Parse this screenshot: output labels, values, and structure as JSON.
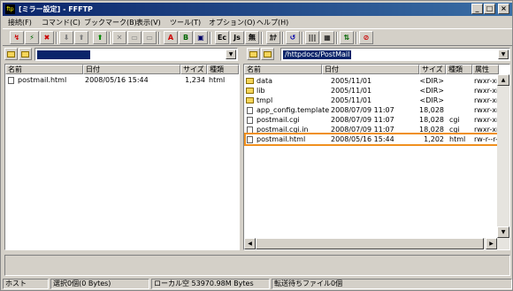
{
  "window": {
    "title": "[ミラー設定] - FFFTP",
    "app_icon_text": "ftp",
    "controls": {
      "minimize": "_",
      "maximize": "□",
      "close": "×"
    }
  },
  "menu": [
    "接続(F)",
    "コマンド(C)",
    "ブックマーク(B)",
    "表示(V)",
    "ツール(T)",
    "オプション(O)",
    "ヘルプ(H)"
  ],
  "toolbar": {
    "buttons": [
      "↯",
      "⚡",
      "✖",
      "⬇",
      "⬆",
      "⬆",
      "✕",
      "▭",
      "▭",
      "A",
      "B",
      "▣",
      "Ec",
      "Js",
      "無",
      "ｶﾅ",
      "↺",
      "|||",
      "▦",
      "⇅",
      "⊘"
    ]
  },
  "local": {
    "path": "",
    "headers": {
      "name": "名前",
      "date": "日付",
      "size": "サイズ",
      "type": "種類"
    },
    "files": [
      {
        "name": "postmail.html",
        "date": "2008/05/16 15:44",
        "size": "1,234",
        "type": "html"
      }
    ]
  },
  "remote": {
    "path": "/httpdocs/PostMail",
    "headers": {
      "name": "名前",
      "date": "日付",
      "size": "サイズ",
      "type": "種類",
      "attr": "属性"
    },
    "files": [
      {
        "name": "data",
        "date": "2005/11/01",
        "size": "<DIR>",
        "type": "",
        "attr": "rwxr-xr-x",
        "kind": "folder"
      },
      {
        "name": "lib",
        "date": "2005/11/01",
        "size": "<DIR>",
        "type": "",
        "attr": "rwxr-xr-x",
        "kind": "folder"
      },
      {
        "name": "tmpl",
        "date": "2005/11/01",
        "size": "<DIR>",
        "type": "",
        "attr": "rwxr-xr-x",
        "kind": "folder"
      },
      {
        "name": "app_config.template",
        "date": "2008/07/09 11:07",
        "size": "18,028",
        "type": "",
        "attr": "rwxr-xr-x",
        "kind": "file"
      },
      {
        "name": "postmail.cgi",
        "date": "2008/07/09 11:07",
        "size": "18,028",
        "type": "cgi",
        "attr": "rwxr-xr-x",
        "kind": "file"
      },
      {
        "name": "postmail.cgi.in",
        "date": "2008/07/09 11:07",
        "size": "18,028",
        "type": "cgi",
        "attr": "rwxr-xr-x",
        "kind": "file"
      },
      {
        "name": "postmail.html",
        "date": "2008/05/16 15:44",
        "size": "1,202",
        "type": "html",
        "attr": "rw-r--r--",
        "kind": "file"
      }
    ],
    "highlight_color": "#f0901e"
  },
  "status": {
    "host": "ホスト",
    "selection": "選択0個(0 Bytes)",
    "local_free": "ローカル空 53970.98M Bytes",
    "queue": "転送待ちファイル0個"
  }
}
